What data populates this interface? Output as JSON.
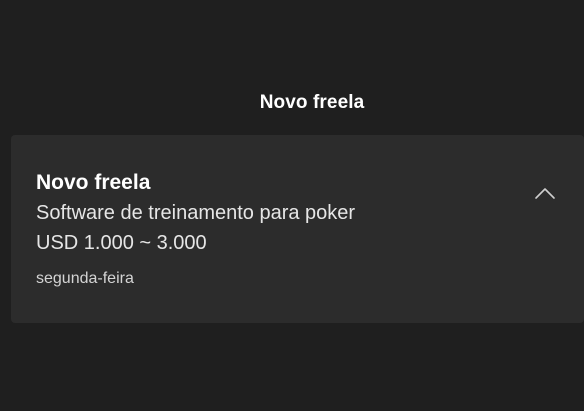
{
  "group": {
    "header": "Novo freela"
  },
  "notification": {
    "title": "Novo freela",
    "line1": "Software de treinamento para poker",
    "line2": "USD 1.000 ~ 3.000",
    "time": "segunda-feira",
    "collapse_icon": "chevron-up-icon"
  }
}
